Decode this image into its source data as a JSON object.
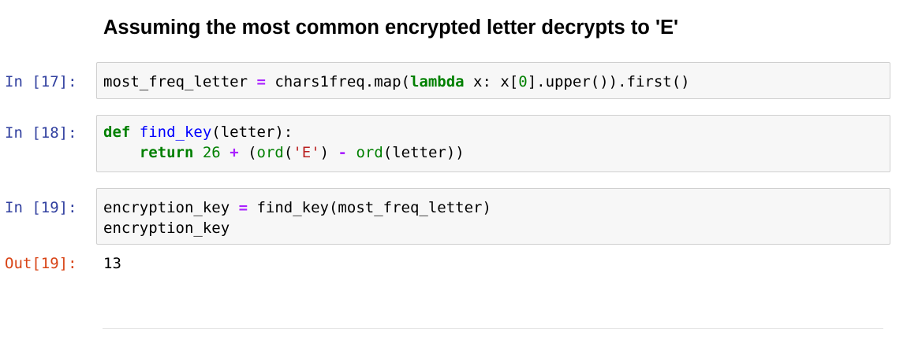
{
  "markdown": {
    "heading": "Assuming the most common encrypted letter decrypts to 'E'"
  },
  "cells": [
    {
      "prompt": "In [17]:",
      "tokens": {
        "t1": "most_freq_letter ",
        "t2": "=",
        "t3": " chars1freq.map(",
        "t4": "lambda",
        "t5": " x: x[",
        "t6": "0",
        "t7": "].upper()).first()"
      }
    },
    {
      "prompt": "In [18]:",
      "tokens": {
        "t1": "def",
        "t2": " ",
        "t3": "find_key",
        "t4": "(letter):",
        "t5": "    ",
        "t6": "return",
        "t7": " ",
        "t8": "26",
        "t9": " ",
        "t10": "+",
        "t11": " (",
        "t12": "ord",
        "t13": "(",
        "t14": "'E'",
        "t15": ") ",
        "t16": "-",
        "t17": " ",
        "t18": "ord",
        "t19": "(letter))"
      }
    },
    {
      "prompt": "In [19]:",
      "tokens": {
        "t1": "encryption_key ",
        "t2": "=",
        "t3": " find_key(most_freq_letter)",
        "t4": "encryption_key"
      },
      "output_prompt": "Out[19]:",
      "output": "13"
    }
  ],
  "colors": {
    "input_prompt": "#303f9f",
    "output_prompt": "#d84315",
    "keyword": "#008000",
    "operator": "#aa22ff",
    "function_name": "#0000ff",
    "string": "#ba2121",
    "cell_background": "#f7f7f7",
    "cell_border": "#cfcfcf"
  }
}
